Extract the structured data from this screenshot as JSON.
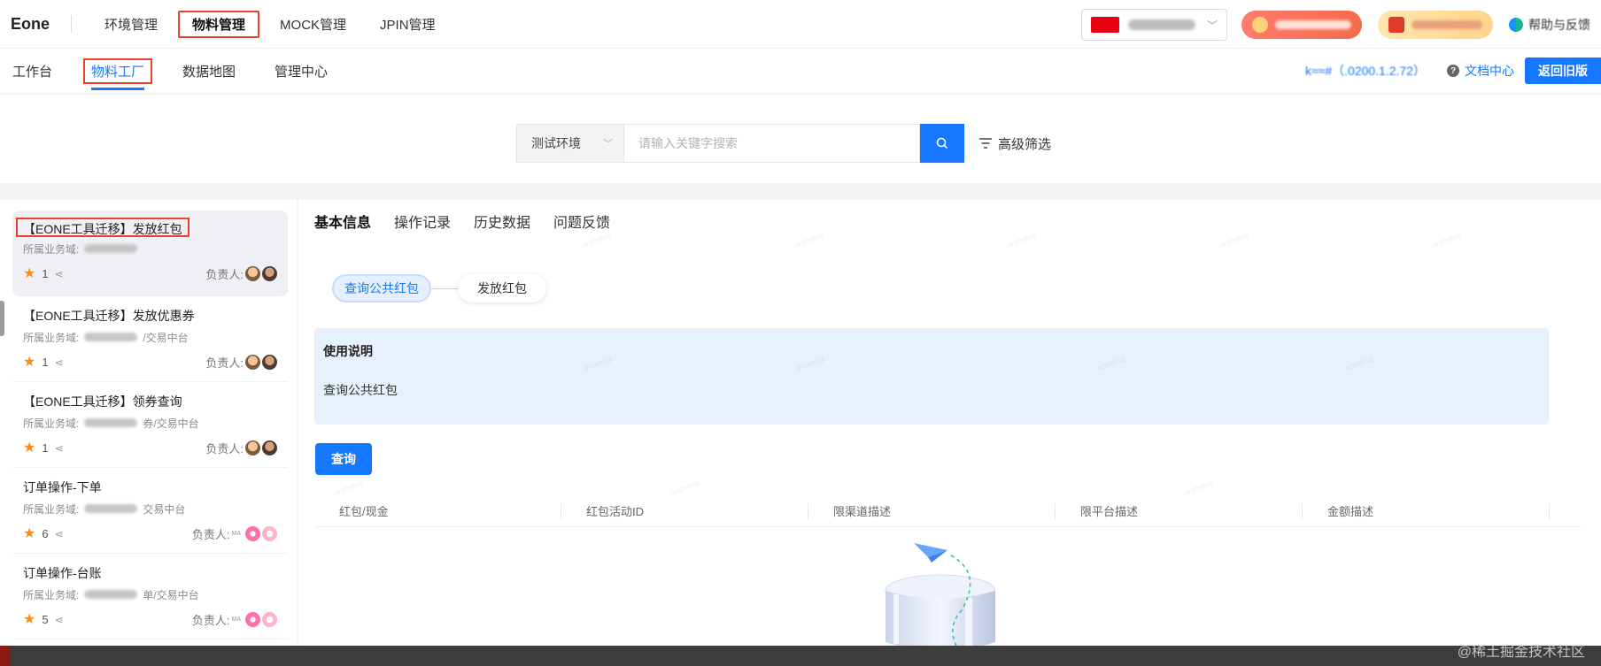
{
  "app": {
    "logo": "Eone"
  },
  "top_nav": {
    "items": [
      {
        "label": "环境管理",
        "active": false
      },
      {
        "label": "物料管理",
        "active": true
      },
      {
        "label": "MOCK管理",
        "active": false
      },
      {
        "label": "JPIN管理",
        "active": false
      }
    ],
    "site_select": {
      "label": "中国测试站"
    },
    "help_label": "帮助与反馈"
  },
  "sub_nav": {
    "items": [
      {
        "label": "工作台",
        "active": false
      },
      {
        "label": "物料工厂",
        "active": true
      },
      {
        "label": "数据地图",
        "active": false
      },
      {
        "label": "管理中心",
        "active": false
      }
    ],
    "user_info": "k≈≈#（.0200.1.2.72）",
    "doc_center": "文档中心",
    "return_old": "返回旧版"
  },
  "search": {
    "env": "测试环境",
    "placeholder": "请输入关键字搜索",
    "value": "",
    "advanced_filter": "高级筛选"
  },
  "material_list": [
    {
      "title": "【EONE工具迁移】发放红包",
      "domain_label": "所属业务域:",
      "domain": "营销域/红包",
      "stars": "1",
      "owner_label": "负责人:",
      "active": true
    },
    {
      "title": "【EONE工具迁移】发放优惠券",
      "domain_label": "所属业务域:",
      "domain": "营销域/优惠券/交易中台",
      "stars": "1",
      "owner_label": "负责人:",
      "active": false
    },
    {
      "title": "【EONE工具迁移】领券查询",
      "domain_label": "所属业务域:",
      "domain": "营销域/优惠券/交易中台",
      "stars": "1",
      "owner_label": "负责人:",
      "active": false
    },
    {
      "title": "订单操作-下单",
      "domain_label": "所属业务域:",
      "domain": "交易域/订单/交易中台",
      "stars": "6",
      "owner_label": "负责人:",
      "active": false
    },
    {
      "title": "订单操作-台账",
      "domain_label": "所属业务域:",
      "domain": "交易域/订单/交易中台",
      "stars": "5",
      "owner_label": "负责人:",
      "active": false
    }
  ],
  "detail": {
    "tabs": [
      {
        "label": "基本信息",
        "active": true
      },
      {
        "label": "操作记录",
        "active": false
      },
      {
        "label": "历史数据",
        "active": false
      },
      {
        "label": "问题反馈",
        "active": false
      }
    ],
    "steps": [
      {
        "label": "查询公共红包",
        "active": true
      },
      {
        "label": "发放红包",
        "active": false
      }
    ],
    "usage_title": "使用说明",
    "usage_desc": "查询公共红包",
    "query_button": "查询",
    "table_columns": [
      "红包/现金",
      "红包活动ID",
      "限渠道描述",
      "限平台描述",
      "金额描述"
    ]
  },
  "footer_watermark": "@稀土掘金技术社区",
  "colors": {
    "primary": "#1677ff",
    "highlight_box": "#e8412e",
    "usage_bg": "#e6f1fd",
    "star": "#fa8c16"
  }
}
